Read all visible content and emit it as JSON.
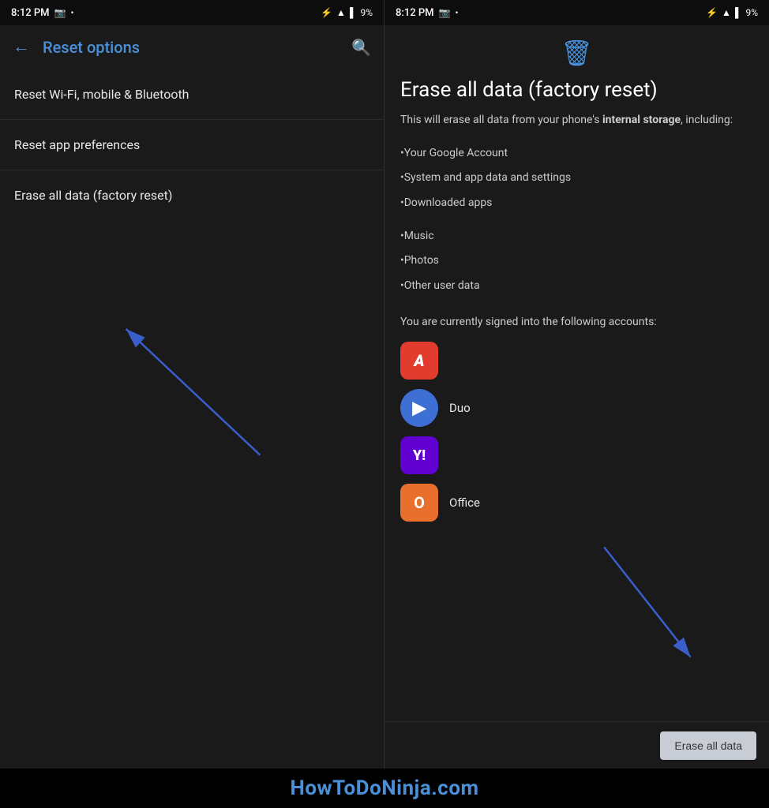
{
  "left_status": {
    "time": "8:12 PM",
    "battery": "9%"
  },
  "right_status": {
    "time": "8:12 PM",
    "battery": "9%"
  },
  "toolbar": {
    "title": "Reset options",
    "back_label": "←",
    "search_label": "🔍"
  },
  "menu": {
    "items": [
      {
        "label": "Reset Wi-Fi, mobile & Bluetooth"
      },
      {
        "label": "Reset app preferences"
      },
      {
        "label": "Erase all data (factory reset)"
      }
    ]
  },
  "erase_screen": {
    "title": "Erase all data (factory reset)",
    "description_prefix": "This will erase all data from your phone's ",
    "description_bold": "internal storage",
    "description_suffix": ", including:",
    "list_items": [
      "•Your Google Account",
      "•System and app data and settings",
      "•Downloaded apps",
      "•Music",
      "•Photos",
      "•Other user data"
    ],
    "accounts_text": "You are currently signed into the following accounts:",
    "accounts": [
      {
        "name": "",
        "icon_type": "adobe"
      },
      {
        "name": "Duo",
        "icon_type": "duo"
      },
      {
        "name": "",
        "icon_type": "yahoo"
      },
      {
        "name": "Office",
        "icon_type": "office"
      }
    ]
  },
  "bottom_button": {
    "label": "Erase all data"
  },
  "watermark": {
    "text": "HowToDoNinja.com"
  }
}
